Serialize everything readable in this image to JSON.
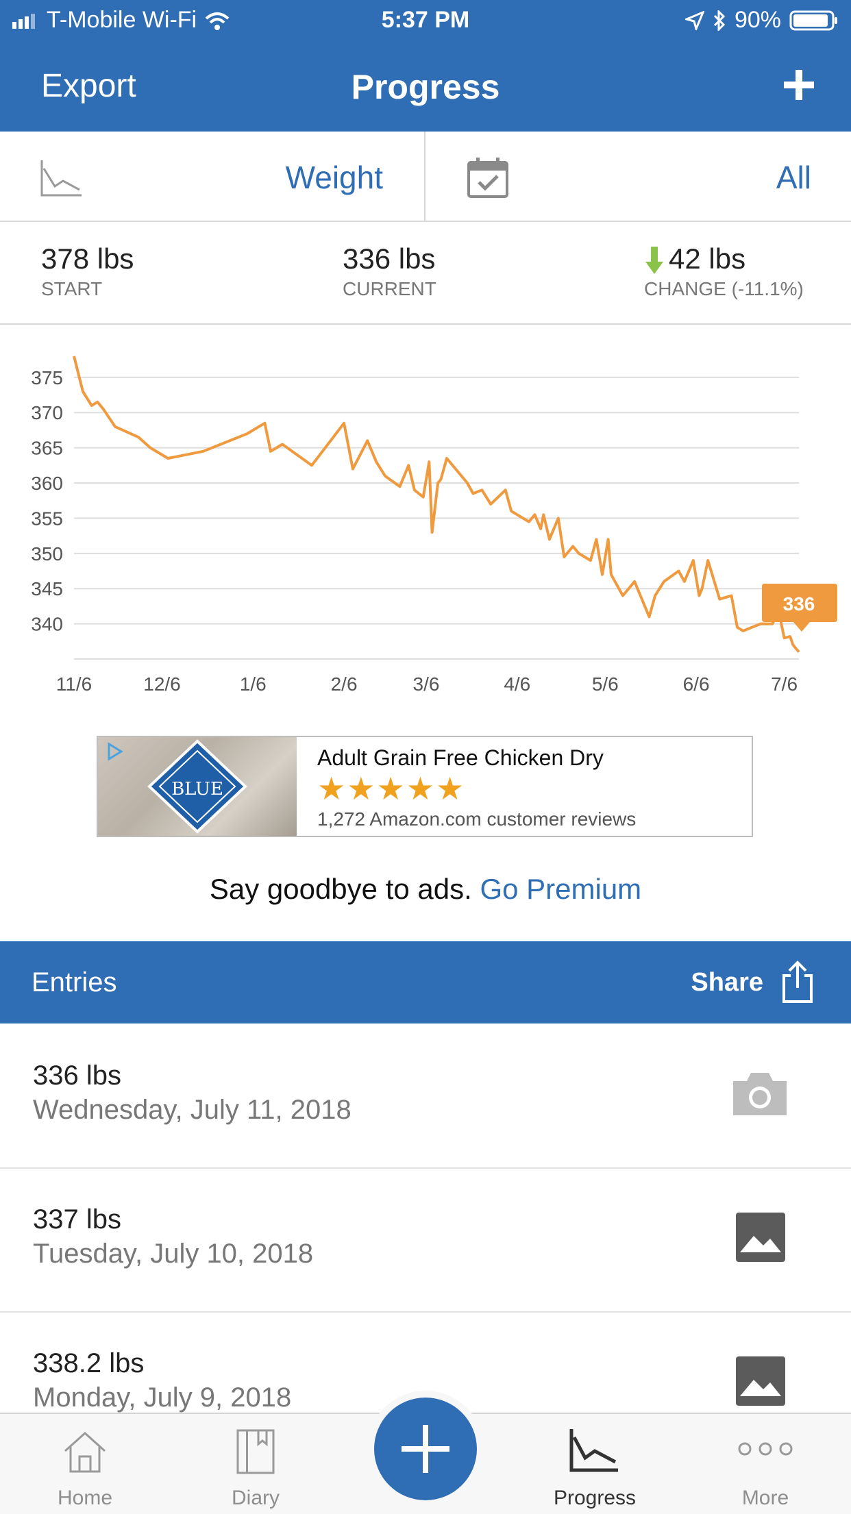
{
  "status": {
    "carrier": "T-Mobile Wi-Fi",
    "time": "5:37 PM",
    "battery": "90%"
  },
  "nav": {
    "export_label": "Export",
    "title": "Progress",
    "add_icon": "plus-icon"
  },
  "selector": {
    "metric_label": "Weight",
    "range_label": "All",
    "chart_icon": "chart-icon",
    "calendar_icon": "calendar-icon"
  },
  "summary": {
    "start_value": "378 lbs",
    "start_label": "START",
    "current_value": "336 lbs",
    "current_label": "CURRENT",
    "change_value": "42 lbs",
    "change_label": "CHANGE (-11.1%)"
  },
  "chart_data": {
    "type": "line",
    "x": [
      "11/6",
      "11/9",
      "11/12",
      "11/14",
      "11/16",
      "11/20",
      "11/28",
      "12/2",
      "12/8",
      "12/20",
      "1/4",
      "1/10",
      "1/12",
      "1/16",
      "1/26",
      "2/6",
      "2/9",
      "2/14",
      "2/17",
      "2/20",
      "2/25",
      "2/28",
      "3/2",
      "3/5",
      "3/7",
      "3/8",
      "3/10",
      "3/11",
      "3/13",
      "3/20",
      "3/22",
      "3/25",
      "3/28",
      "4/2",
      "4/4",
      "4/6",
      "4/10",
      "4/12",
      "4/14",
      "4/15",
      "4/17",
      "4/20",
      "4/22",
      "4/25",
      "4/27",
      "5/1",
      "5/3",
      "5/5",
      "5/7",
      "5/8",
      "5/12",
      "5/16",
      "5/21",
      "5/23",
      "5/26",
      "5/31",
      "6/2",
      "6/5",
      "6/7",
      "6/8",
      "6/10",
      "6/14",
      "6/18",
      "6/20",
      "6/22",
      "6/25",
      "6/28",
      "7/2",
      "7/4",
      "7/6",
      "7/8",
      "7/9",
      "7/10",
      "7/11"
    ],
    "values": [
      378,
      373,
      371,
      371.5,
      370.5,
      368,
      366.5,
      365,
      363.5,
      364.5,
      367,
      368.5,
      364.5,
      365.5,
      362.5,
      368.5,
      362,
      366,
      363,
      361,
      359.5,
      362.5,
      359,
      358,
      363,
      353,
      360,
      360.5,
      363.5,
      360,
      358.5,
      359,
      357,
      359,
      356,
      355.5,
      354.5,
      355.5,
      353.5,
      355.5,
      352,
      355,
      349.5,
      351,
      350,
      349,
      352,
      347,
      352,
      347,
      344,
      346,
      341,
      344,
      346,
      347.5,
      346,
      349,
      344,
      345,
      349,
      343.5,
      344,
      339.5,
      339,
      339.5,
      340,
      340,
      342,
      338,
      338.2,
      337,
      336.5,
      336
    ],
    "x_ticks": [
      "11/6",
      "12/6",
      "1/6",
      "2/6",
      "3/6",
      "4/6",
      "5/6",
      "6/6",
      "7/6"
    ],
    "y_ticks": [
      375,
      370,
      365,
      360,
      355,
      350,
      345,
      340
    ],
    "ylim": [
      335,
      378
    ],
    "callout": "336",
    "line_color": "#ef9a3e",
    "grid": true
  },
  "ad": {
    "title": "Adult Grain Free Chicken Dry",
    "stars": "★★★★★",
    "rating": 4.5,
    "reviews": "1,272 Amazon.com customer reviews",
    "brand": "BLUE"
  },
  "premium": {
    "text": "Say goodbye to ads.",
    "link": "Go Premium"
  },
  "entries_header": {
    "title": "Entries",
    "share_label": "Share"
  },
  "entries": [
    {
      "weight": "336 lbs",
      "date": "Wednesday, July 11, 2018",
      "icon": "camera-icon"
    },
    {
      "weight": "337 lbs",
      "date": "Tuesday, July 10, 2018",
      "icon": "photo-icon"
    },
    {
      "weight": "338.2 lbs",
      "date": "Monday, July 9, 2018",
      "icon": "photo-icon"
    }
  ],
  "tabs": [
    {
      "label": "Home",
      "icon": "home-icon"
    },
    {
      "label": "Diary",
      "icon": "book-icon"
    },
    {
      "label": "",
      "icon": "plus-icon"
    },
    {
      "label": "Progress",
      "icon": "chart-icon"
    },
    {
      "label": "More",
      "icon": "more-icon"
    }
  ],
  "colors": {
    "brand_blue": "#2f6db5",
    "chart_orange": "#ef9a3e",
    "change_green": "#8bc34a"
  }
}
